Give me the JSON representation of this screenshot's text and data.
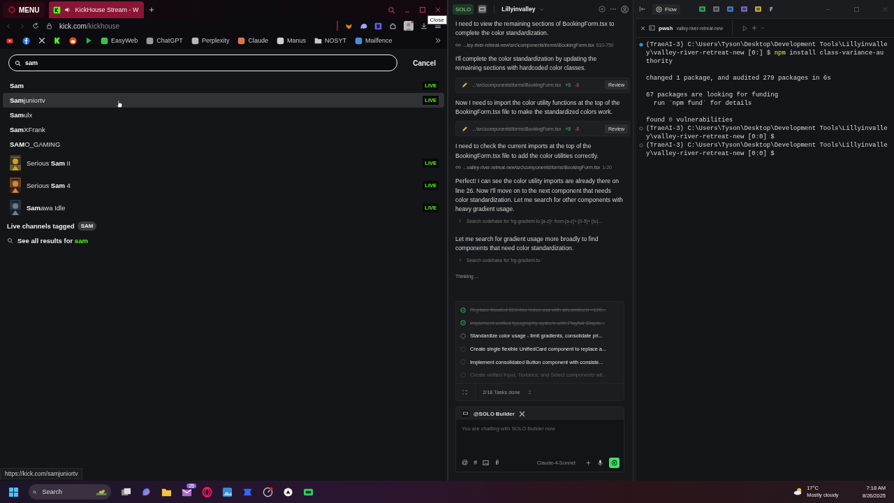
{
  "browser": {
    "menu_label": "MENU",
    "tab": {
      "title": "KickHouse Stream - W",
      "selected": true
    },
    "tooltip": "Close",
    "address": {
      "host": "kick.com",
      "path": "/kickhouse"
    },
    "bookmarks": [
      {
        "label": "EasyWeb",
        "kind": "site",
        "color": "#3fbf4a"
      },
      {
        "label": "ChatGPT",
        "kind": "site",
        "color": "#9a9a9a"
      },
      {
        "label": "Perplexity",
        "kind": "site",
        "color": "#b8b8b8"
      },
      {
        "label": "Claude",
        "kind": "site",
        "color": "#d9774b"
      },
      {
        "label": "Manus",
        "kind": "site",
        "color": "#d0d0d0"
      },
      {
        "label": "NOSYT",
        "kind": "folder",
        "color": "#c8c8c8"
      },
      {
        "label": "Mailfence",
        "kind": "site",
        "color": "#4a8fd9"
      }
    ],
    "search": {
      "value": "sam",
      "action": "Cancel"
    },
    "results": [
      {
        "name": "**Sam**",
        "kind": "channel",
        "badge": "LIVE",
        "selected": false
      },
      {
        "name": "**Sam**juniortv",
        "kind": "channel",
        "badge": "LIVE",
        "selected": true
      },
      {
        "name": "**Sam**ulx",
        "kind": "channel",
        "selected": false
      },
      {
        "name": "**Sam**XFrank",
        "kind": "channel",
        "selected": false
      },
      {
        "name": "**SAM**O_GAMING",
        "kind": "channel",
        "selected": false
      },
      {
        "name": "Serious **Sam** II",
        "kind": "category",
        "badge": "LIVE",
        "selected": false
      },
      {
        "name": "Serious **Sam** 4",
        "kind": "category",
        "badge": "LIVE",
        "selected": false
      },
      {
        "name": "**Sam**awa Idle",
        "kind": "category",
        "badge": "LIVE",
        "selected": false
      }
    ],
    "tagged": {
      "label": "Live channels tagged",
      "tag": "SAM"
    },
    "see_all": {
      "label": "See all results for",
      "query": "sam"
    },
    "status_url": "https://kick.com/samjuniortv"
  },
  "assistant": {
    "badge": "SOLO",
    "project": "Lillyinvalley",
    "messages": [
      {
        "kind": "text",
        "text": "I need to view the remaining sections of BookingForm.tsx to complete the color standardization."
      },
      {
        "kind": "file_ref",
        "path": "...ley-river-retreat-new\\src\\components\\forms\\BookingForm.tsx",
        "range": "610-750"
      },
      {
        "kind": "text",
        "text": "I'll complete the color standardization by updating the remaining sections with hardcoded color classes."
      },
      {
        "kind": "edit",
        "path": "...\\src\\components\\forms\\BookingForm.tsx",
        "added": "+6",
        "removed": "-6",
        "action": "Review"
      },
      {
        "kind": "text",
        "text": "Now I need to import the color utility functions at the top of the BookingForm.tsx file to make the standardized colors work."
      },
      {
        "kind": "edit",
        "path": "...\\src\\components\\forms\\BookingForm.tsx",
        "added": "+8",
        "removed": "-8",
        "action": "Review"
      },
      {
        "kind": "text",
        "text": "I need to check the current imports at the top of the BookingForm.tsx file to add the color utilities correctly."
      },
      {
        "kind": "file_ref",
        "path": "...valley-river-retreat-new\\src\\components\\forms\\BookingForm.tsx",
        "range": "1-20"
      },
      {
        "kind": "text",
        "text": "Perfect! I can see the color utility imports are already there on line 26. Now I'll move on to the next component that needs color standardization. Let me search for other components with heavy gradient usage."
      },
      {
        "kind": "search",
        "text": "Search codebase for 'bg-gradient-to-[a-z]+ from-[a-z]+-[0-9]+ (to|..."
      },
      {
        "kind": "text",
        "text": "Let me search for gradient usage more broadly to find components that need color standardization."
      },
      {
        "kind": "search",
        "text": "Search codebase for 'bg-gradient-to-'"
      },
      {
        "kind": "status",
        "text": "Thinking ..."
      }
    ],
    "tasks": [
      {
        "text": "Replace bloated 810-line index.css with streamlined <100...",
        "done": true,
        "active": false
      },
      {
        "text": "Implement unified typography system with Playfair Displa...",
        "done": true,
        "active": false
      },
      {
        "text": "Standardize color usage - limit gradients, consolidate pri...",
        "done": false,
        "active": true
      },
      {
        "text": "Create single flexible UnifiedCard component to replace a...",
        "done": false,
        "active": false
      },
      {
        "text": "Implement consolidated Button component with consiste...",
        "done": false,
        "active": false
      },
      {
        "text": "Create unified Input, Textarea, and Select components wit...",
        "done": false,
        "active": false
      }
    ],
    "tasks_summary": "2/18 Tasks done",
    "composer": {
      "agent": "@SOLO Builder",
      "placeholder": "You are chatting with SOLO Builder now",
      "symbols": [
        "@",
        "#"
      ],
      "model": "Claude-4-Sonnet"
    }
  },
  "ide": {
    "flow_label": "Flow",
    "terminal_tab": {
      "name": "pwsh",
      "folder": "valley-river-retreat-new"
    },
    "blocks": [
      {
        "kind": "prompt",
        "active": true,
        "prompt": "(TraeAI-3) C:\\Users\\Tyson\\Desktop\\Development Tools\\Lillyinvalley\\valley-river-retreat-new [0:] $",
        "program": "npm",
        "args": "install class-variance-authority"
      },
      {
        "kind": "output",
        "lines": [
          "changed 1 package, and audited 279 packages in 6s"
        ]
      },
      {
        "kind": "output",
        "lines": [
          "67 packages are looking for funding",
          "  run `npm fund` for details"
        ]
      },
      {
        "kind": "summary",
        "before": "found",
        "count": "0",
        "after": "vulnerabilities"
      },
      {
        "kind": "prompt",
        "active": false,
        "prompt": "(TraeAI-3) C:\\Users\\Tyson\\Desktop\\Development Tools\\Lillyinvalley\\valley-river-retreat-new [0:0] $"
      },
      {
        "kind": "prompt",
        "active": false,
        "prompt": "(TraeAI-3) C:\\Users\\Tyson\\Desktop\\Development Tools\\Lillyinvalley\\valley-river-retreat-new [0:0] $"
      }
    ]
  },
  "taskbar": {
    "search_placeholder": "Search",
    "mail_badge": "25",
    "weather": {
      "temp": "17°C",
      "condition": "Mostly cloudy"
    },
    "clock": {
      "time": "7:18 AM",
      "date": "8/26/2025"
    }
  }
}
